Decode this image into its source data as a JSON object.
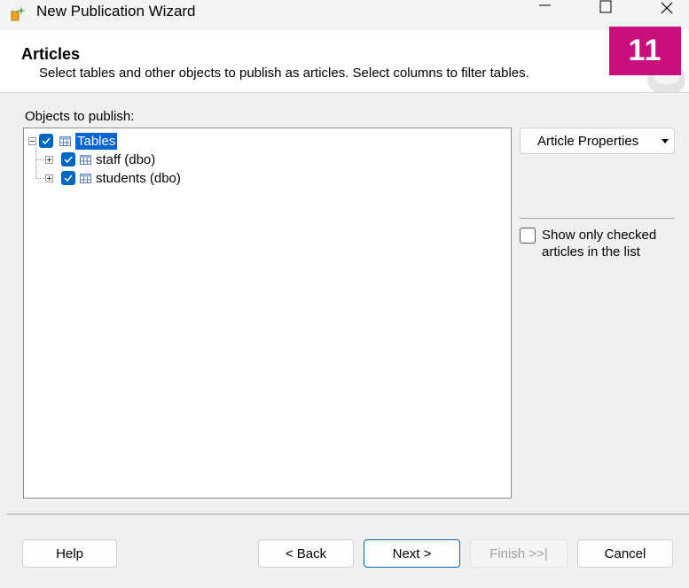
{
  "window": {
    "title": "New Publication Wizard",
    "minimize_glyph": "—",
    "maximize_glyph": "☐",
    "close_glyph": "✕"
  },
  "header": {
    "heading": "Articles",
    "description": "Select tables and other objects to publish as articles. Select columns to filter tables."
  },
  "badge": "11",
  "objects_label": "Objects to publish:",
  "tree": {
    "root": {
      "label": "Tables",
      "checked": true,
      "selected": true,
      "icon": "table-icon"
    },
    "children": [
      {
        "label": "staff (dbo)",
        "checked": true,
        "icon": "table-icon"
      },
      {
        "label": "students (dbo)",
        "checked": true,
        "icon": "table-icon"
      }
    ]
  },
  "article_properties": {
    "label": "Article Properties",
    "arrow": "▼"
  },
  "show_only_checked": {
    "label": "Show only checked articles in the list",
    "checked": false
  },
  "buttons": {
    "help": "Help",
    "back": "< Back",
    "next": "Next >",
    "finish": "Finish >>|",
    "cancel": "Cancel"
  },
  "colors": {
    "accent": "#0067c0",
    "selection": "#0a64d2",
    "badge": "#c90f7c"
  }
}
